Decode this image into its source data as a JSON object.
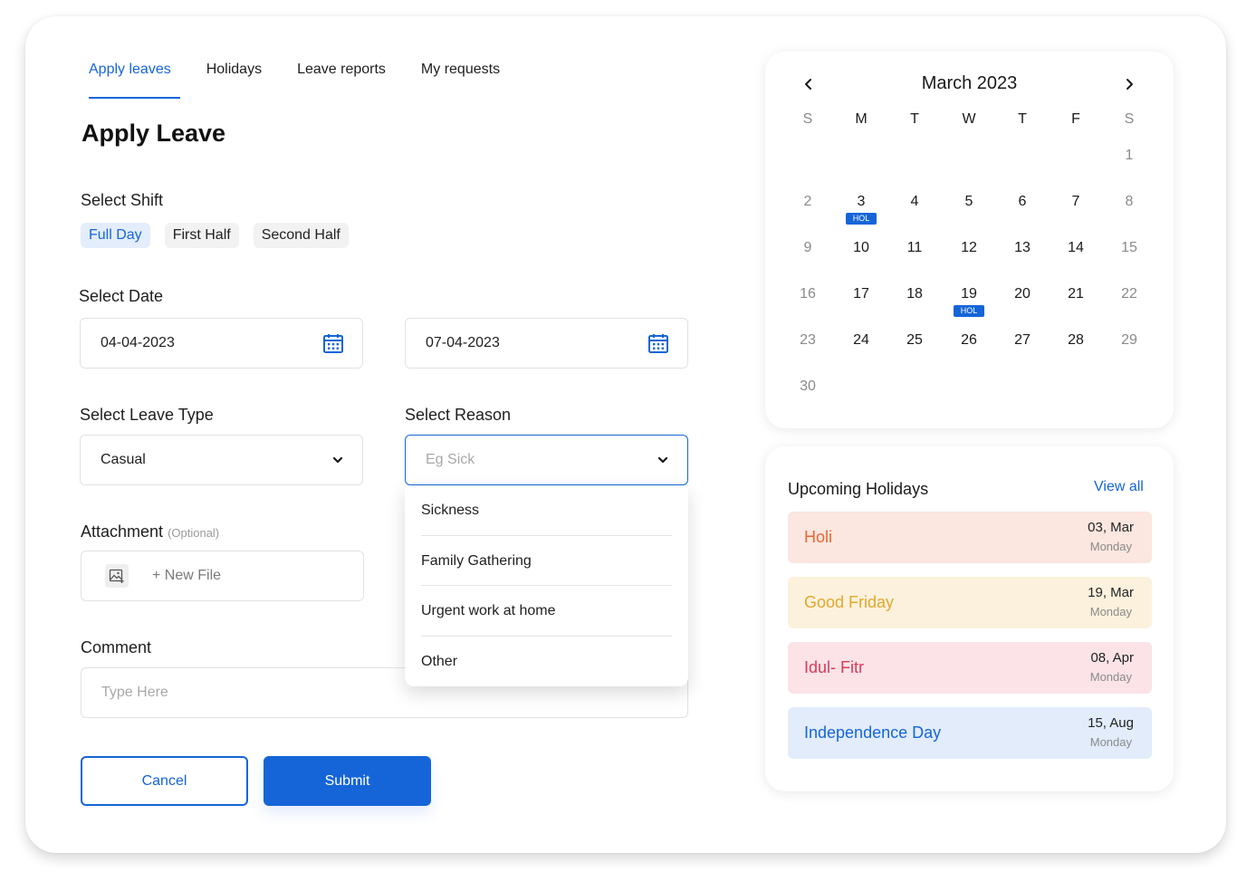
{
  "tabs": [
    {
      "label": "Apply leaves",
      "active": true
    },
    {
      "label": "Holidays",
      "active": false
    },
    {
      "label": "Leave reports",
      "active": false
    },
    {
      "label": "My requests",
      "active": false
    }
  ],
  "page_title": "Apply Leave",
  "shift": {
    "label": "Select Shift",
    "options": [
      "Full Day",
      "First Half",
      "Second Half"
    ],
    "selected": "Full Day"
  },
  "date": {
    "label": "Select Date",
    "from": "04-04-2023",
    "to": "07-04-2023"
  },
  "leave_type": {
    "label": "Select Leave Type",
    "value": "Casual"
  },
  "reason": {
    "label": "Select Reason",
    "placeholder": "Eg Sick",
    "options": [
      "Sickness",
      "Family Gathering",
      "Urgent work at home",
      "Other"
    ]
  },
  "attachment": {
    "label": "Attachment",
    "optional": "(Optional)",
    "new_file": "+ New File"
  },
  "comment": {
    "label": "Comment",
    "placeholder": "Type Here"
  },
  "buttons": {
    "cancel": "Cancel",
    "submit": "Submit"
  },
  "calendar": {
    "title": "March 2023",
    "weekdays": [
      "S",
      "M",
      "T",
      "W",
      "T",
      "F",
      "S"
    ],
    "weeks": [
      [
        "",
        "",
        "",
        "",
        "",
        "",
        "1"
      ],
      [
        "2",
        "3",
        "4",
        "5",
        "6",
        "7",
        "8"
      ],
      [
        "9",
        "10",
        "11",
        "12",
        "13",
        "14",
        "15"
      ],
      [
        "16",
        "17",
        "18",
        "19",
        "20",
        "21",
        "22"
      ],
      [
        "23",
        "24",
        "25",
        "26",
        "27",
        "28",
        "29"
      ],
      [
        "30",
        "",
        "",
        "",
        "",
        "",
        ""
      ]
    ],
    "holiday_days": [
      "3",
      "19"
    ],
    "holiday_tag": "HOL"
  },
  "holidays": {
    "heading": "Upcoming Holidays",
    "view_all": "View all",
    "items": [
      {
        "name": "Holi",
        "date": "03, Mar",
        "weekday": "Monday",
        "bg": "#fbe6e0",
        "color": "#e8672f"
      },
      {
        "name": "Good Friday",
        "date": "19, Mar",
        "weekday": "Monday",
        "bg": "#fcf1dc",
        "color": "#e3a72e"
      },
      {
        "name": "Idul- Fitr",
        "date": "08, Apr",
        "weekday": "Monday",
        "bg": "#fbe3e8",
        "color": "#d83a57"
      },
      {
        "name": "Independence Day",
        "date": "15, Aug",
        "weekday": "Monday",
        "bg": "#e2ecfb",
        "color": "#1565d8"
      }
    ]
  },
  "colors": {
    "accent": "#1565d8"
  }
}
